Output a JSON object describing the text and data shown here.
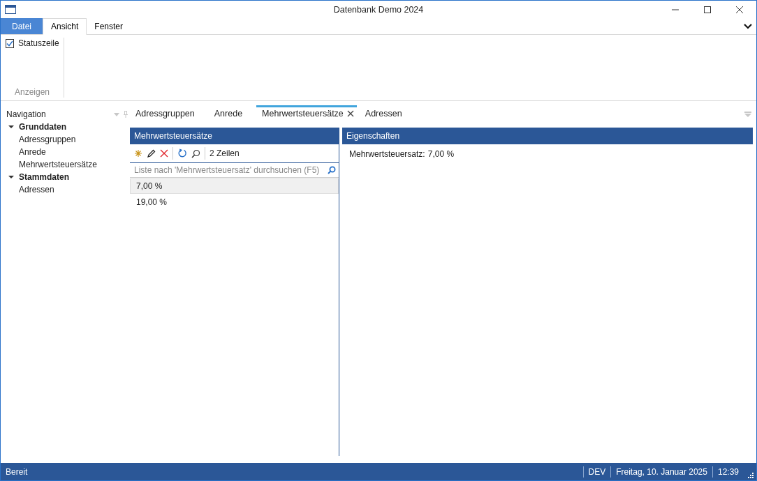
{
  "window": {
    "title": "Datenbank Demo 2024"
  },
  "ribbon_tabs": [
    {
      "label": "Datei",
      "kind": "file",
      "selected": false
    },
    {
      "label": "Ansicht",
      "kind": "tab",
      "selected": true
    },
    {
      "label": "Fenster",
      "kind": "tab",
      "selected": false
    }
  ],
  "ribbon": {
    "groups": [
      {
        "label": "Anzeigen",
        "items": [
          {
            "label": "Statuszeile",
            "checked": true
          }
        ]
      }
    ]
  },
  "navigation": {
    "title": "Navigation",
    "items": [
      {
        "label": "Grunddaten",
        "expanded": true,
        "children": [
          {
            "label": "Adressgruppen"
          },
          {
            "label": "Anrede"
          },
          {
            "label": "Mehrwertsteuersätze"
          }
        ]
      },
      {
        "label": "Stammdaten",
        "expanded": true,
        "children": [
          {
            "label": "Adressen"
          }
        ]
      }
    ]
  },
  "document_tabs": [
    {
      "label": "Adressgruppen",
      "selected": false
    },
    {
      "label": "Anrede",
      "selected": false
    },
    {
      "label": "Mehrwertsteuersätze",
      "selected": true
    },
    {
      "label": "Adressen",
      "selected": false
    }
  ],
  "list_panel": {
    "title": "Mehrwertsteuersätze",
    "row_count": "2 Zeilen",
    "search": {
      "placeholder": "Liste nach 'Mehrwertsteuersatz' durchsuchen (F5)"
    },
    "rows": [
      {
        "text": "7,00 %",
        "selected": true
      },
      {
        "text": "19,00 %",
        "selected": false
      }
    ]
  },
  "properties_panel": {
    "title": "Eigenschaften",
    "fields": [
      {
        "label": "Mehrwertsteuersatz:",
        "value": "7,00 %"
      }
    ]
  },
  "status_bar": {
    "text": "Bereit",
    "cells": [
      "DEV",
      "Freitag, 10. Januar 2025",
      "12:39"
    ]
  }
}
